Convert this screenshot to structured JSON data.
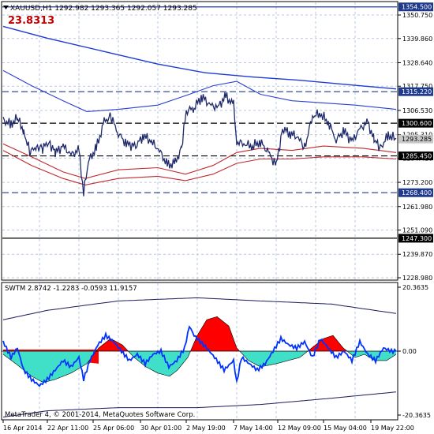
{
  "header": {
    "symbol_line": "XAUUSD,H1  1292.982 1293.365 1292.057 1293.285",
    "big_value": "23.8313",
    "big_value_color": "#c00000"
  },
  "price_axis": {
    "ticks": [
      "1350.750",
      "1339.860",
      "1328.640",
      "1317.750",
      "1306.530",
      "1295.310",
      "1284.420",
      "1273.200",
      "1261.980",
      "1251.090",
      "1239.870",
      "1228.980"
    ],
    "tick_values": [
      1350.75,
      1339.86,
      1328.64,
      1317.75,
      1306.53,
      1295.31,
      1284.42,
      1273.2,
      1261.98,
      1251.09,
      1239.87,
      1228.98
    ],
    "labels": [
      {
        "text": "1354.500",
        "value": 1354.5,
        "bg": "#1f3a8a",
        "fg": "#ffffff"
      },
      {
        "text": "1315.220",
        "value": 1315.22,
        "bg": "#1f3a8a",
        "fg": "#ffffff"
      },
      {
        "text": "1300.600",
        "value": 1300.6,
        "bg": "#000000",
        "fg": "#ffffff"
      },
      {
        "text": "1293.285",
        "value": 1293.285,
        "bg": "#c8c8c8",
        "fg": "#000000"
      },
      {
        "text": "1285.450",
        "value": 1285.45,
        "bg": "#000000",
        "fg": "#ffffff"
      },
      {
        "text": "1268.400",
        "value": 1268.4,
        "bg": "#1f3a8a",
        "fg": "#ffffff"
      },
      {
        "text": "1247.300",
        "value": 1247.3,
        "bg": "#000000",
        "fg": "#ffffff"
      }
    ]
  },
  "levels": [
    {
      "value": 1354.5,
      "style": "solid",
      "color": "#1f3a8a"
    },
    {
      "value": 1315.22,
      "style": "dash",
      "color": "#1f3a8a"
    },
    {
      "value": 1300.6,
      "style": "dash",
      "color": "#000000"
    },
    {
      "value": 1285.45,
      "style": "dash",
      "color": "#000000"
    },
    {
      "value": 1268.4,
      "style": "dash",
      "color": "#1f3a8a"
    },
    {
      "value": 1247.3,
      "style": "solid",
      "color": "#000000"
    }
  ],
  "indicator": {
    "title": "SWTM  2.8742 -1.2283 -0.0593 11.9157",
    "ticks": [
      "20.3635",
      "0.00",
      "-20.3635"
    ],
    "tick_values": [
      20.3635,
      0,
      -20.3635
    ]
  },
  "time_axis": {
    "labels": [
      "16 Apr 2014",
      "22 Apr 11:00",
      "25 Apr 06:00",
      "30 Apr 01:00",
      "2 May 19:00",
      "7 May 14:00",
      "12 May 09:00",
      "15 May 04:00",
      "19 May 22:00"
    ]
  },
  "copyright": "MetaTrader 4, © 2001-2014, MetaQuotes Software Corp.",
  "colors": {
    "price": "#1f2a6b",
    "ma_slow": "#1f3ad6",
    "band": "#2b3fd0",
    "red_band": "#c0282c",
    "grid": "#b9c8df",
    "hist_red": "#ff0000",
    "hist_cyan": "#40e0c8"
  },
  "chart_data": [
    {
      "type": "line",
      "title": "XAUUSD,H1",
      "x": [
        "16 Apr 2014",
        "22 Apr 11:00",
        "25 Apr 06:00",
        "30 Apr 01:00",
        "2 May 19:00",
        "7 May 14:00",
        "12 May 09:00",
        "15 May 04:00",
        "19 May 22:00"
      ],
      "series": [
        {
          "name": "",
          "values": [
            1302,
            1287,
            1289,
            1281,
            1309,
            1284,
            1297,
            1296,
            1293.3
          ]
        }
      ],
      "ylim": [
        1228.98,
        1354.5
      ]
    },
    {
      "type": "area",
      "title": "SWTM",
      "x": [
        "16 Apr 2014",
        "22 Apr 11:00",
        "25 Apr 06:00",
        "30 Apr 01:00",
        "2 May 19:00",
        "7 May 14:00",
        "12 May 09:00",
        "15 May 04:00",
        "19 May 22:00"
      ],
      "series": [
        {
          "name": "",
          "values": [
            -4,
            -6,
            3,
            3,
            8,
            -3,
            -4,
            2,
            -0.06
          ]
        }
      ],
      "ylim": [
        -20.3635,
        20.3635
      ]
    }
  ]
}
